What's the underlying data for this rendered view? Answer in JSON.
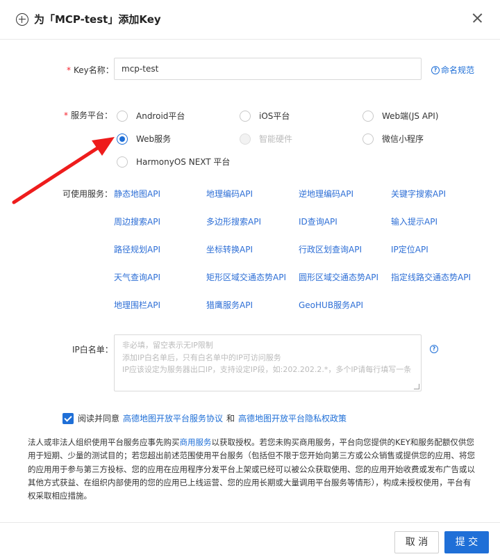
{
  "dialog": {
    "title": "为「MCP-test」添加Key",
    "icon": "plus-circle-icon"
  },
  "key_name": {
    "required_mark": "*",
    "label": "Key名称：",
    "value": "mcp-test",
    "help_link": "命名规范"
  },
  "platform": {
    "required_mark": "*",
    "label": "服务平台：",
    "options": [
      {
        "label": "Android平台",
        "checked": false,
        "disabled": false
      },
      {
        "label": "iOS平台",
        "checked": false,
        "disabled": false
      },
      {
        "label": "Web端(JS API)",
        "checked": false,
        "disabled": false
      },
      {
        "label": "Web服务",
        "checked": true,
        "disabled": false
      },
      {
        "label": "智能硬件",
        "checked": false,
        "disabled": true
      },
      {
        "label": "微信小程序",
        "checked": false,
        "disabled": false
      },
      {
        "label": "HarmonyOS NEXT 平台",
        "checked": false,
        "disabled": false
      }
    ]
  },
  "services": {
    "label": "可使用服务：",
    "items": [
      "静态地图API",
      "地理编码API",
      "逆地理编码API",
      "关键字搜索API",
      "周边搜索API",
      "多边形搜索API",
      "ID查询API",
      "输入提示API",
      "路径规划API",
      "坐标转换API",
      "行政区划查询API",
      "IP定位API",
      "天气查询API",
      "矩形区域交通态势API",
      "圆形区域交通态势API",
      "指定线路交通态势API",
      "地理围栏API",
      "猎鹰服务API",
      "GeoHUB服务API"
    ]
  },
  "ip_whitelist": {
    "label": "IP白名单：",
    "placeholder_lines": [
      "非必填，留空表示无IP限制",
      "添加IP白名单后，只有白名单中的IP可访问服务",
      "IP应该设定为服务器出口IP，支持设定IP段，如:202.202.2.*，多个IP请每行填写一条"
    ]
  },
  "agreement": {
    "checked": true,
    "prefix": "阅读并同意",
    "link1": "高德地图开放平台服务协议",
    "and": "和",
    "link2": "高德地图开放平台隐私权政策"
  },
  "notice": {
    "part1": "法人或非法人组织使用平台服务应事先购买",
    "link": "商用服务",
    "part2": "以获取授权。若您未购买商用服务，平台向您提供的KEY和服务配额仅供您用于短期、少量的测试目的；若您超出前述范围使用平台服务（包括但不限于您开始向第三方或公众销售或提供您的应用、将您的应用用于参与第三方投标、您的应用在应用程序分发平台上架或已经可以被公众获取使用、您的应用开始收费或发布广告或以其他方式获益、在组织内部使用的您的应用已上线运营、您的应用长期或大量调用平台服务等情形），构成未授权使用，平台有权采取相应措施。"
  },
  "footer": {
    "cancel": "取 消",
    "submit": "提 交"
  },
  "colors": {
    "primary": "#1f6fd7",
    "required": "#f5222d",
    "annotation_arrow": "#ee1c1c"
  }
}
